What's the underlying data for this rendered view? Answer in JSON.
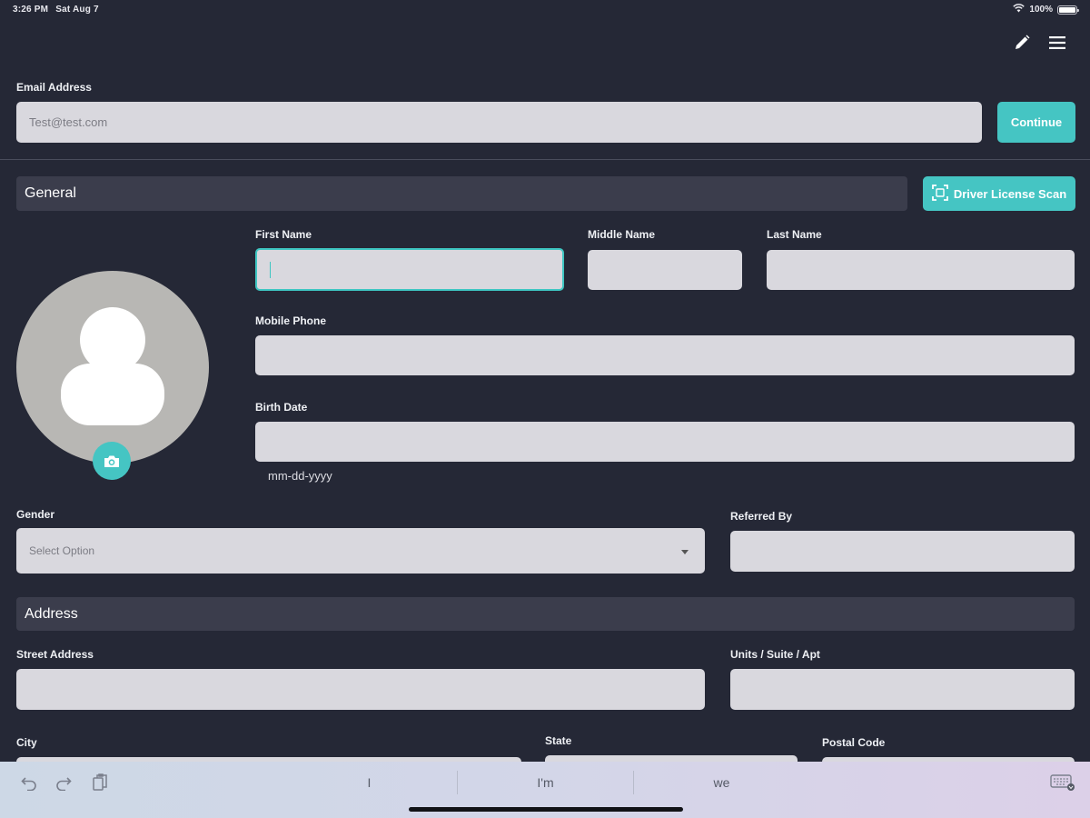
{
  "status_bar": {
    "time": "3:26 PM",
    "date": "Sat Aug 7",
    "battery": "100%"
  },
  "email": {
    "label": "Email Address",
    "placeholder": "Test@test.com",
    "value": "",
    "continue_label": "Continue"
  },
  "general": {
    "header": "General",
    "scan_button": "Driver License Scan",
    "first_name": {
      "label": "First Name",
      "value": ""
    },
    "middle_name": {
      "label": "Middle Name",
      "value": ""
    },
    "last_name": {
      "label": "Last Name",
      "value": ""
    },
    "mobile_phone": {
      "label": "Mobile Phone",
      "value": ""
    },
    "birth_date": {
      "label": "Birth Date",
      "value": "",
      "hint": "mm-dd-yyyy"
    },
    "gender": {
      "label": "Gender",
      "selected": "Select Option"
    },
    "referred_by": {
      "label": "Referred By",
      "value": ""
    }
  },
  "address": {
    "header": "Address",
    "street": {
      "label": "Street Address",
      "value": ""
    },
    "unit": {
      "label": "Units / Suite / Apt",
      "value": ""
    },
    "city": {
      "label": "City",
      "value": ""
    },
    "state": {
      "label": "State",
      "value": ""
    },
    "postal_code": {
      "label": "Postal Code",
      "value": ""
    }
  },
  "keyboard": {
    "suggestions": [
      "I",
      "I'm",
      "we"
    ]
  },
  "icons": {
    "edit": "pencil-icon",
    "menu": "hamburger-menu-icon",
    "scan": "scan-icon",
    "camera": "camera-icon",
    "avatar": "person-icon",
    "dropdown": "chevron-down-icon",
    "undo": "undo-icon",
    "redo": "redo-icon",
    "paste": "clipboard-icon",
    "keyboard": "keyboard-dismiss-icon",
    "wifi": "wifi-icon",
    "battery": "battery-icon"
  },
  "colors": {
    "background": "#252836",
    "accent": "#45c5c3",
    "field": "#d9d8de",
    "section": "#3b3d4c"
  }
}
